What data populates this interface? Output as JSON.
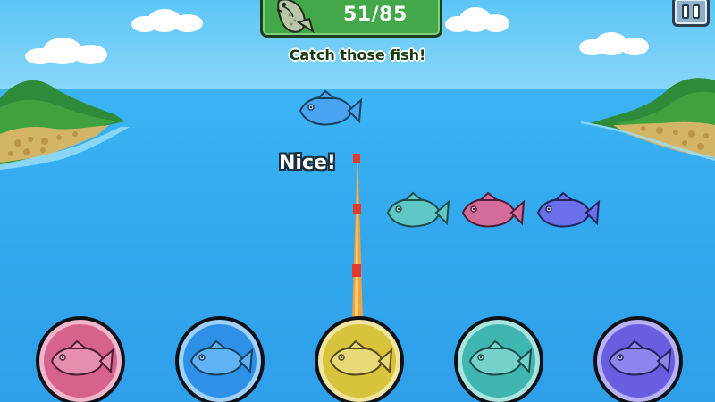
{
  "hud": {
    "caught": "51/85",
    "subtitle": "Catch those fish!",
    "pause_icon": "pause-icon",
    "score_icon": "fish-icon"
  },
  "feedback": "Nice!",
  "swimming_fish": [
    {
      "color": "#4aa3f2"
    },
    {
      "color": "#5fc7c4"
    },
    {
      "color": "#d46c9a"
    },
    {
      "color": "#6a70ea"
    }
  ],
  "buttons": [
    {
      "name": "pink",
      "color": "#d6628e",
      "fish": "#e58fb0"
    },
    {
      "name": "blue",
      "color": "#2f90e8",
      "fish": "#5fb3f4"
    },
    {
      "name": "yellow",
      "color": "#d7c33c",
      "fish": "#e8d978"
    },
    {
      "name": "teal",
      "color": "#3fb7b0",
      "fish": "#74d2cb"
    },
    {
      "name": "purple",
      "color": "#6a5ee0",
      "fish": "#8c86ef"
    }
  ],
  "colors": {
    "sea": "#33a9ef",
    "panel": "#43a84a",
    "pause": "#8fb0c8"
  }
}
